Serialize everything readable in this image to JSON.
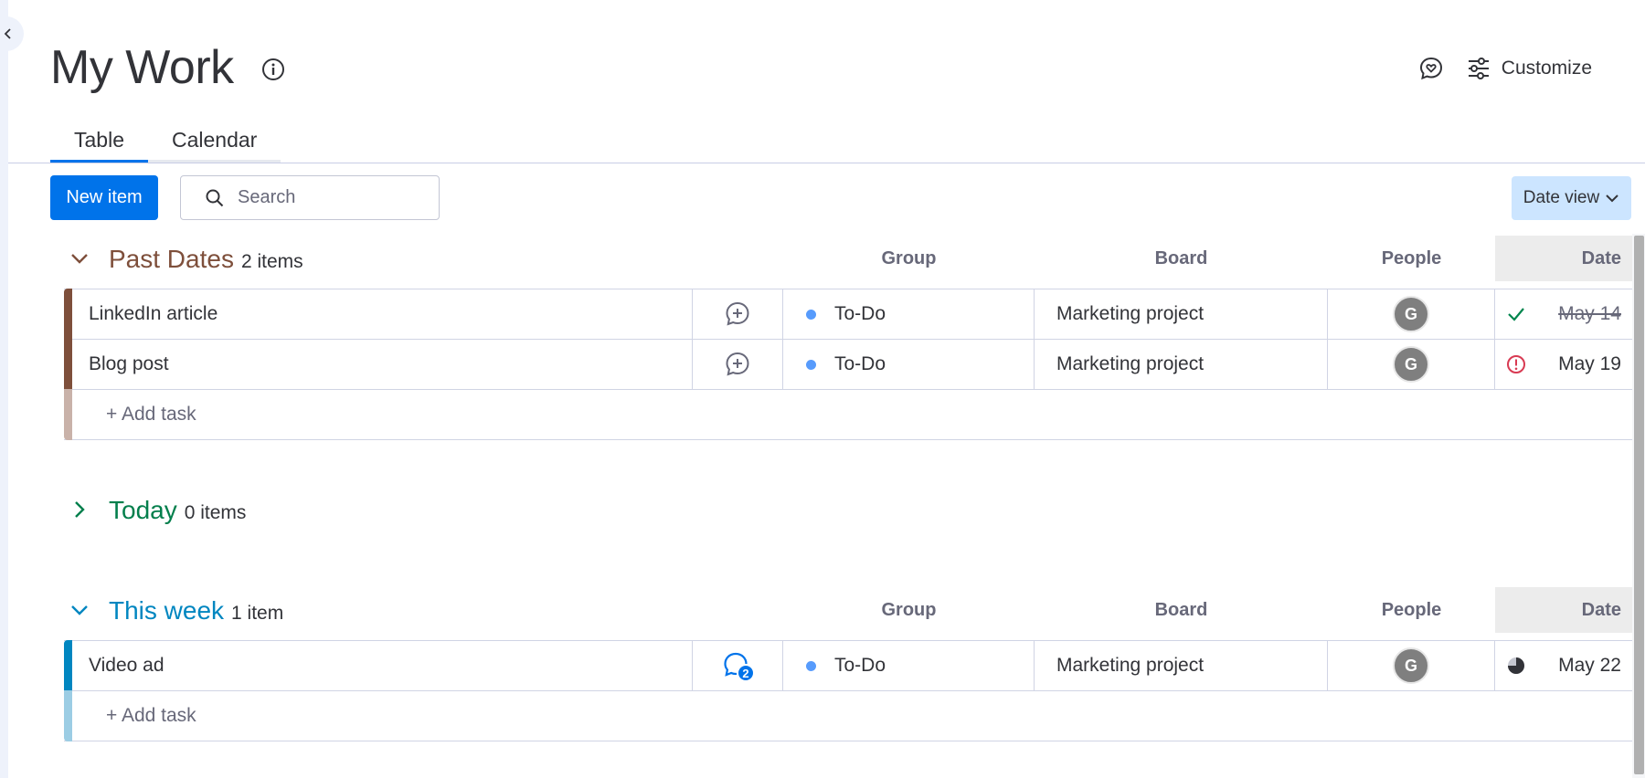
{
  "page": {
    "title": "My Work"
  },
  "header": {
    "customize_label": "Customize"
  },
  "tabs": [
    {
      "label": "Table",
      "active": true
    },
    {
      "label": "Calendar",
      "active": false
    }
  ],
  "toolbar": {
    "new_item_label": "New item",
    "search_placeholder": "Search",
    "date_view_label": "Date view"
  },
  "columns": {
    "group": "Group",
    "board": "Board",
    "people": "People",
    "date": "Date"
  },
  "groups": [
    {
      "title": "Past Dates",
      "count": "2 items",
      "color": "#7e4f3b",
      "bar_color": "#7e4f3b",
      "add_bar_color": "#c9b2a9",
      "expanded": true,
      "add_task_label": "+ Add task",
      "rows": [
        {
          "name": "LinkedIn article",
          "group": "To-Do",
          "board": "Marketing project",
          "person_initial": "G",
          "date": "May 14",
          "date_status": "done"
        },
        {
          "name": "Blog post",
          "group": "To-Do",
          "board": "Marketing project",
          "person_initial": "G",
          "date": "May 19",
          "date_status": "overdue"
        }
      ]
    },
    {
      "title": "Today",
      "count": "0 items",
      "color": "#037f4c",
      "expanded": false
    },
    {
      "title": "This week",
      "count": "1 item",
      "color": "#0086c0",
      "bar_color": "#0086c0",
      "add_bar_color": "#9ccde4",
      "expanded": true,
      "add_task_label": "+ Add task",
      "rows": [
        {
          "name": "Video ad",
          "group": "To-Do",
          "board": "Marketing project",
          "person_initial": "G",
          "date": "May 22",
          "date_status": "in-progress",
          "updates_count": "2"
        }
      ]
    }
  ],
  "colors": {
    "primary": "#0073ea",
    "status_dot": "#579bfc",
    "done_check": "#00854d",
    "overdue": "#d83a52"
  }
}
